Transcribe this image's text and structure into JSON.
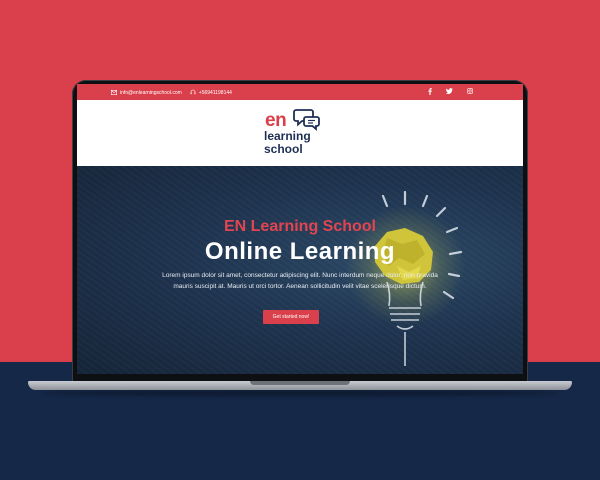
{
  "topbar": {
    "email": "info@enlearningschool.com",
    "phone": "+56941198144",
    "socials": [
      "facebook-icon",
      "twitter-icon",
      "instagram-icon"
    ]
  },
  "logo": {
    "line1": "en",
    "line2": "learning",
    "line3": "school"
  },
  "hero": {
    "subtitle": "EN Learning School",
    "title": "Online Learning",
    "text": "Lorem ipsum dolor sit amet, consectetur adipiscing elit. Nunc interdum neque dolor, non gravida mauris suscipit at. Mauris ut orci tortor. Aenean sollicitudin velit vitae scelerisque dictum.",
    "cta_label": "Get started now!"
  },
  "colors": {
    "accent": "#d9404b",
    "navy": "#152848",
    "logo_navy": "#1e2f55"
  }
}
